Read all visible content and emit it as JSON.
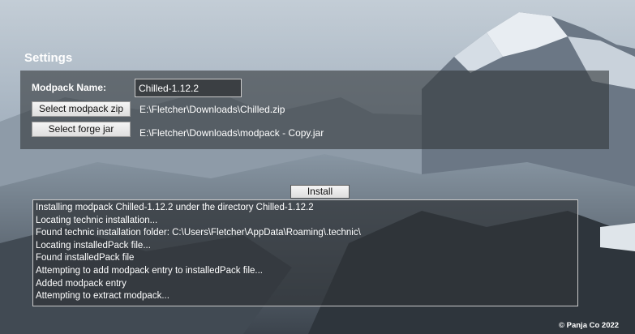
{
  "settings": {
    "title": "Settings"
  },
  "modpack": {
    "name_label": "Modpack Name:",
    "name_value": "Chilled-1.12.2",
    "select_zip_label": "Select modpack zip",
    "zip_path": "E:\\Fletcher\\Downloads\\Chilled.zip",
    "select_forge_label": "Select forge jar",
    "forge_path": "E:\\Fletcher\\Downloads\\modpack - Copy.jar"
  },
  "install": {
    "button_label": "Install"
  },
  "log": {
    "lines": [
      "Installing modpack Chilled-1.12.2 under the directory Chilled-1.12.2",
      "Locating technic installation...",
      "Found technic installation folder: C:\\Users\\Fletcher\\AppData\\Roaming\\.technic\\",
      "Locating installedPack file...",
      "Found installedPack file",
      "Attempting to add modpack entry to installedPack file...",
      "Added modpack entry",
      "Attempting to extract modpack..."
    ]
  },
  "footer": {
    "copyright": "© Panja Co 2022"
  }
}
